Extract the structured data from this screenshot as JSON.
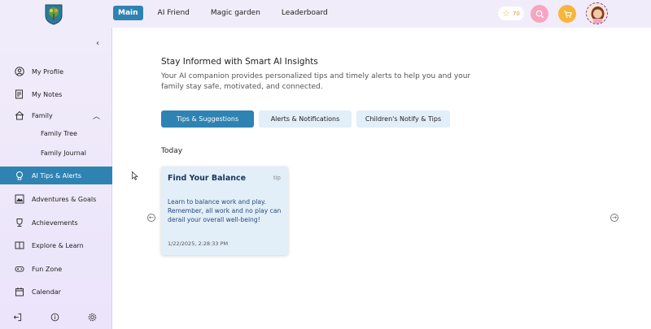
{
  "header": {
    "nav": [
      {
        "label": "Main",
        "active": true
      },
      {
        "label": "AI Friend",
        "active": false
      },
      {
        "label": "Magic garden",
        "active": false
      },
      {
        "label": "Leaderboard",
        "active": false
      }
    ],
    "stars_count": "70"
  },
  "sidebar": {
    "items": [
      {
        "label": "My Profile",
        "icon": "user-circle-icon"
      },
      {
        "label": "My Notes",
        "icon": "notes-icon"
      },
      {
        "label": "Family",
        "icon": "family-icon"
      },
      {
        "label": "AI Tips & Alerts",
        "icon": "lightbulb-icon"
      },
      {
        "label": "Adventures & Goals",
        "icon": "mountain-icon"
      },
      {
        "label": "Achievements",
        "icon": "trophy-icon"
      },
      {
        "label": "Explore & Learn",
        "icon": "book-icon"
      },
      {
        "label": "Fun Zone",
        "icon": "gamepad-icon"
      },
      {
        "label": "Calendar",
        "icon": "calendar-icon"
      }
    ],
    "family_sub": [
      "Family Tree",
      "Family Journal"
    ]
  },
  "main": {
    "heading": "Stay Informed with Smart AI Insights",
    "description": "Your AI companion provides personalized tips and timely alerts to help you and your family stay safe, motivated, and connected.",
    "tabs": [
      "Tips & Suggestions",
      "Alerts & Notifications",
      "Children's Notify & Tips"
    ],
    "section_label": "Today",
    "card": {
      "title": "Find Your Balance",
      "tag": "tip",
      "body": "Learn to balance work and play. Remember, all work and no play can derail your overall well-being!",
      "timestamp": "1/22/2025, 2:28:33 PM"
    }
  },
  "colors": {
    "accent": "#2f83b3",
    "sidebar_bg": "#f1ecfa",
    "card_bg": "#e2eef8"
  }
}
